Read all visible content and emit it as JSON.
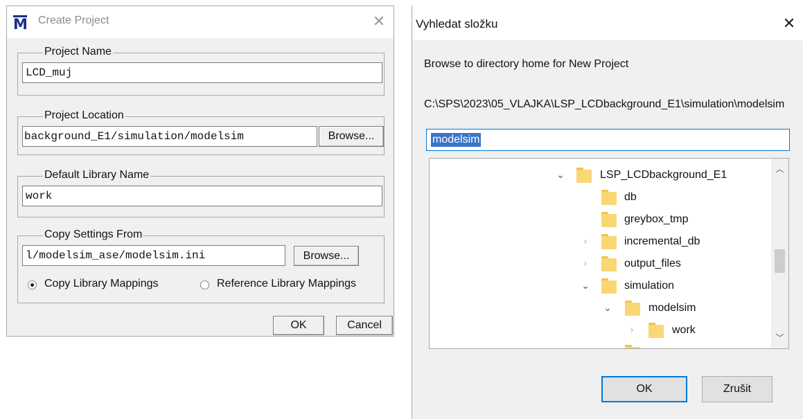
{
  "create_project": {
    "title": "Create Project",
    "logo_letter": "M",
    "close_glyph": "✕",
    "groups": {
      "project_name": {
        "label": "Project Name",
        "value": "LCD_muj"
      },
      "project_location": {
        "label": "Project Location",
        "value": "background_E1/simulation/modelsim",
        "browse_label": "Browse..."
      },
      "default_library": {
        "label": "Default Library Name",
        "value": "work"
      },
      "copy_settings": {
        "label": "Copy Settings From",
        "value": "l/modelsim_ase/modelsim.ini",
        "browse_label": "Browse...",
        "radio_copy_label": "Copy Library Mappings",
        "radio_reference_label": "Reference Library Mappings",
        "selected": "copy"
      }
    },
    "ok_label": "OK",
    "cancel_label": "Cancel"
  },
  "browse_folder": {
    "title": "Vyhledat složku",
    "close_glyph": "✕",
    "description": "Browse to directory home for New Project",
    "current_path": "C:\\SPS\\2023\\05_VLAJKA\\LSP_LCDbackground_E1\\simulation\\modelsim",
    "folder_input_value": "modelsim",
    "tree": [
      {
        "label": "LSP_LCDbackground_E1",
        "state": "expanded"
      },
      {
        "label": "db",
        "state": "none"
      },
      {
        "label": "greybox_tmp",
        "state": "none"
      },
      {
        "label": "incremental_db",
        "state": "collapsed"
      },
      {
        "label": "output_files",
        "state": "collapsed"
      },
      {
        "label": "simulation",
        "state": "expanded"
      },
      {
        "label": "modelsim",
        "state": "expanded"
      },
      {
        "label": "work",
        "state": "collapsed"
      }
    ],
    "ok_label": "OK",
    "cancel_label": "Zrušit"
  }
}
